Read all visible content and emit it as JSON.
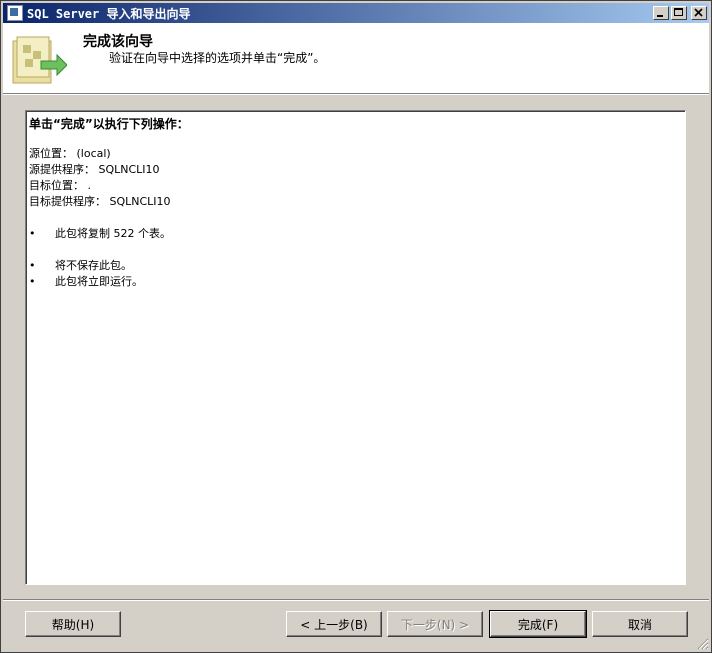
{
  "window": {
    "title": "SQL Server 导入和导出向导"
  },
  "header": {
    "title": "完成该向导",
    "subtitle": "验证在向导中选择的选项并单击“完成”。"
  },
  "summary": {
    "heading": "单击“完成”以执行下列操作：",
    "lines": [
      "源位置： (local)",
      "源提供程序： SQLNCLI10",
      "目标位置： .",
      "目标提供程序： SQLNCLI10"
    ],
    "bullet_glyph": "•",
    "bullets_group1": [
      "此包将复制 522 个表。"
    ],
    "bullets_group2": [
      "将不保存此包。",
      "此包将立即运行。"
    ]
  },
  "buttons": {
    "help": "帮助(H)",
    "back": "< 上一步(B)",
    "next": "下一步(N) >",
    "finish": "完成(F)",
    "cancel": "取消"
  },
  "icons": {
    "app": "app-icon",
    "wizard": "wizard-finish-icon",
    "minimize": "minimize-icon",
    "maximize": "maximize-icon",
    "close": "close-icon",
    "grip": "resize-grip-icon"
  }
}
